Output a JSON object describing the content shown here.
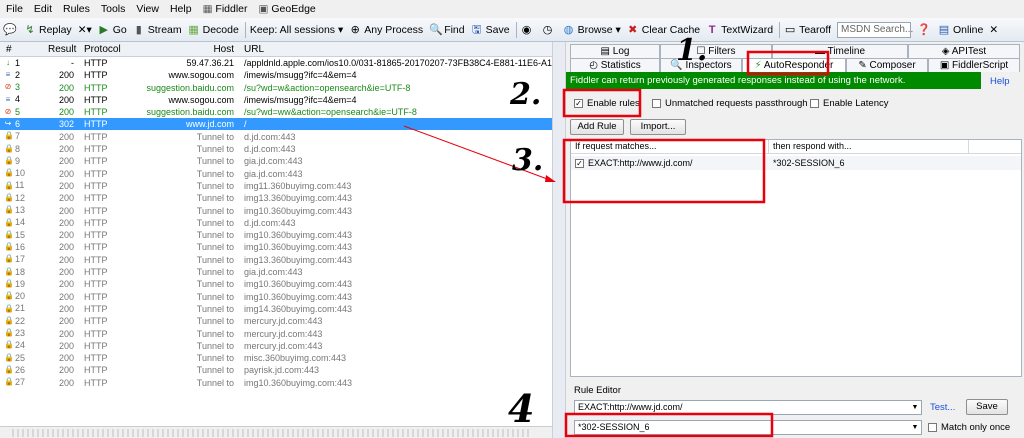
{
  "menu": [
    "File",
    "Edit",
    "Rules",
    "Tools",
    "View",
    "Help",
    "Fiddler",
    "GeoEdge"
  ],
  "toolbar": {
    "replay": "Replay",
    "remove": "✕▾",
    "go": "Go",
    "stream": "Stream",
    "decode": "Decode",
    "keep": "Keep: All sessions ▾",
    "any_process": "Any Process",
    "find": "Find",
    "save": "Save",
    "browse": "Browse ▾",
    "clear_cache": "Clear Cache",
    "textwizard": "TextWizard",
    "tearoff": "Tearoff",
    "search_placeholder": "MSDN Search...",
    "online": "Online"
  },
  "columns": {
    "num": "#",
    "result": "Result",
    "protocol": "Protocol",
    "host": "Host",
    "url": "URL"
  },
  "sessions": [
    {
      "n": "1",
      "r": "-",
      "p": "HTTP",
      "h": "59.47.36.21",
      "u": "/appldnld.apple.com/ios10.0/031-81865-20170207-73FB38C4-E881-11E6-A145-",
      "s": "normal",
      "i": "down"
    },
    {
      "n": "2",
      "r": "200",
      "p": "HTTP",
      "h": "www.sogou.com",
      "u": "/imewis/msugg?ifc=4&em=4",
      "s": "normal",
      "i": "doc"
    },
    {
      "n": "3",
      "r": "200",
      "p": "HTTP",
      "h": "suggestion.baidu.com",
      "u": "/su?wd=w&action=opensearch&ie=UTF-8",
      "s": "green",
      "i": "err"
    },
    {
      "n": "4",
      "r": "200",
      "p": "HTTP",
      "h": "www.sogou.com",
      "u": "/imewis/msugg?ifc=4&em=4",
      "s": "normal",
      "i": "doc"
    },
    {
      "n": "5",
      "r": "200",
      "p": "HTTP",
      "h": "suggestion.baidu.com",
      "u": "/su?wd=ww&action=opensearch&ie=UTF-8",
      "s": "green",
      "i": "err"
    },
    {
      "n": "6",
      "r": "302",
      "p": "HTTP",
      "h": "www.jd.com",
      "u": "/",
      "s": "sel",
      "i": "redir"
    },
    {
      "n": "7",
      "r": "200",
      "p": "HTTP",
      "h": "Tunnel to",
      "u": "d.jd.com:443",
      "s": "gray",
      "i": "lock"
    },
    {
      "n": "8",
      "r": "200",
      "p": "HTTP",
      "h": "Tunnel to",
      "u": "d.jd.com:443",
      "s": "gray",
      "i": "lock"
    },
    {
      "n": "9",
      "r": "200",
      "p": "HTTP",
      "h": "Tunnel to",
      "u": "gia.jd.com:443",
      "s": "gray",
      "i": "lock"
    },
    {
      "n": "10",
      "r": "200",
      "p": "HTTP",
      "h": "Tunnel to",
      "u": "gia.jd.com:443",
      "s": "gray",
      "i": "lock"
    },
    {
      "n": "11",
      "r": "200",
      "p": "HTTP",
      "h": "Tunnel to",
      "u": "img11.360buyimg.com:443",
      "s": "gray",
      "i": "lock"
    },
    {
      "n": "12",
      "r": "200",
      "p": "HTTP",
      "h": "Tunnel to",
      "u": "img13.360buyimg.com:443",
      "s": "gray",
      "i": "lock"
    },
    {
      "n": "13",
      "r": "200",
      "p": "HTTP",
      "h": "Tunnel to",
      "u": "img10.360buyimg.com:443",
      "s": "gray",
      "i": "lock"
    },
    {
      "n": "14",
      "r": "200",
      "p": "HTTP",
      "h": "Tunnel to",
      "u": "d.jd.com:443",
      "s": "gray",
      "i": "lock"
    },
    {
      "n": "15",
      "r": "200",
      "p": "HTTP",
      "h": "Tunnel to",
      "u": "img10.360buyimg.com:443",
      "s": "gray",
      "i": "lock"
    },
    {
      "n": "16",
      "r": "200",
      "p": "HTTP",
      "h": "Tunnel to",
      "u": "img10.360buyimg.com:443",
      "s": "gray",
      "i": "lock"
    },
    {
      "n": "17",
      "r": "200",
      "p": "HTTP",
      "h": "Tunnel to",
      "u": "img13.360buyimg.com:443",
      "s": "gray",
      "i": "lock"
    },
    {
      "n": "18",
      "r": "200",
      "p": "HTTP",
      "h": "Tunnel to",
      "u": "gia.jd.com:443",
      "s": "gray",
      "i": "lock"
    },
    {
      "n": "19",
      "r": "200",
      "p": "HTTP",
      "h": "Tunnel to",
      "u": "img10.360buyimg.com:443",
      "s": "gray",
      "i": "lock"
    },
    {
      "n": "20",
      "r": "200",
      "p": "HTTP",
      "h": "Tunnel to",
      "u": "img10.360buyimg.com:443",
      "s": "gray",
      "i": "lock"
    },
    {
      "n": "21",
      "r": "200",
      "p": "HTTP",
      "h": "Tunnel to",
      "u": "img14.360buyimg.com:443",
      "s": "gray",
      "i": "lock"
    },
    {
      "n": "22",
      "r": "200",
      "p": "HTTP",
      "h": "Tunnel to",
      "u": "mercury.jd.com:443",
      "s": "gray",
      "i": "lock"
    },
    {
      "n": "23",
      "r": "200",
      "p": "HTTP",
      "h": "Tunnel to",
      "u": "mercury.jd.com:443",
      "s": "gray",
      "i": "lock"
    },
    {
      "n": "24",
      "r": "200",
      "p": "HTTP",
      "h": "Tunnel to",
      "u": "mercury.jd.com:443",
      "s": "gray",
      "i": "lock"
    },
    {
      "n": "25",
      "r": "200",
      "p": "HTTP",
      "h": "Tunnel to",
      "u": "misc.360buyimg.com:443",
      "s": "gray",
      "i": "lock"
    },
    {
      "n": "26",
      "r": "200",
      "p": "HTTP",
      "h": "Tunnel to",
      "u": "payrisk.jd.com:443",
      "s": "gray",
      "i": "lock"
    },
    {
      "n": "27",
      "r": "200",
      "p": "HTTP",
      "h": "Tunnel to",
      "u": "img10.360buyimg.com:443",
      "s": "gray",
      "i": "lock"
    }
  ],
  "tabs_top": {
    "log": "Log",
    "filters": "Filters",
    "timeline": "Timeline",
    "apitest": "APITest"
  },
  "tabs_bottom": {
    "statistics": "Statistics",
    "inspectors": "Inspectors",
    "autoresponder": "AutoResponder",
    "composer": "Composer",
    "fiddlerscript": "FiddlerScript"
  },
  "autoresponder": {
    "banner": "Fiddler can return previously generated responses instead of using the network.",
    "help": "Help",
    "enable_rules": "Enable rules",
    "unmatched": "Unmatched requests passthrough",
    "latency": "Enable Latency",
    "add_rule": "Add Rule",
    "import": "Import...",
    "col_match": "If request matches...",
    "col_respond": "then respond with...",
    "rule_match": "EXACT:http://www.jd.com/",
    "rule_respond": "*302-SESSION_6",
    "editor_label": "Rule Editor",
    "editor_match": "EXACT:http://www.jd.com/",
    "editor_respond": "*302-SESSION_6",
    "test": "Test...",
    "save": "Save",
    "match_once": "Match only once"
  },
  "annotations": [
    "1.",
    "2.",
    "3.",
    "4"
  ],
  "colors": {
    "highlight_box": "#e8000c",
    "selected_row": "#3399ff",
    "banner": "#008a00",
    "green_row": "#1a8a1a"
  }
}
